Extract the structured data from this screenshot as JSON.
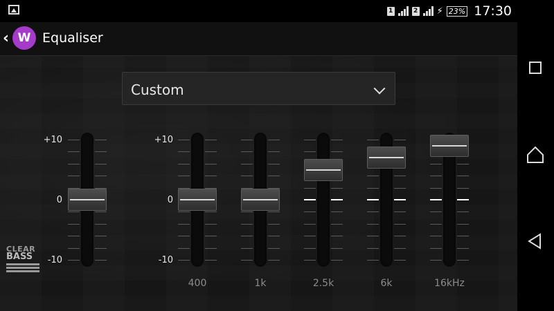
{
  "status_bar": {
    "left_icon": "gallery-icon",
    "sim1": "1",
    "sim2": "2",
    "battery": "23%",
    "time": "17:30"
  },
  "action_bar": {
    "back_icon": "chevron-left-icon",
    "app_icon_glyph": "W",
    "title": "Equaliser"
  },
  "preset_dropdown": {
    "selected": "Custom"
  },
  "scale_labels": {
    "max": "+10",
    "mid": "0",
    "min": "-10"
  },
  "clear_bass": {
    "line1": "CLEAR",
    "line2": "BASS",
    "level": 0
  },
  "bands": [
    {
      "label": "400",
      "level": 0
    },
    {
      "label": "1k",
      "level": 0
    },
    {
      "label": "2.5k",
      "level": 5
    },
    {
      "label": "6k",
      "level": 7
    },
    {
      "label": "16kHz",
      "level": 9
    }
  ],
  "colors": {
    "accent": "#a43cc9",
    "background": "#161616",
    "band_label": "#8c8c8c"
  },
  "nav_bar": {
    "recents_icon": "square-icon",
    "home_icon": "home-icon",
    "back_icon": "back-triangle-icon"
  }
}
